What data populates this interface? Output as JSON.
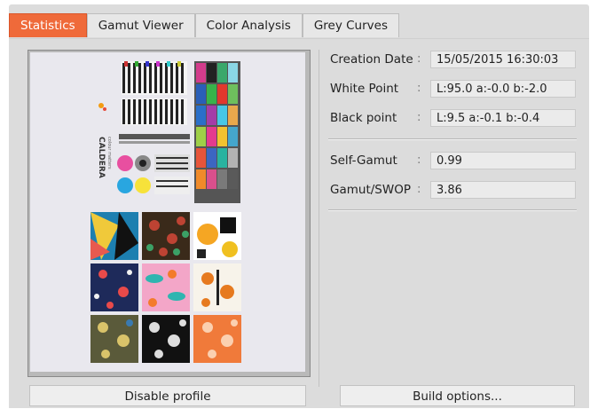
{
  "tabs": [
    {
      "label": "Statistics",
      "active": true
    },
    {
      "label": "Gamut Viewer",
      "active": false
    },
    {
      "label": "Color Analysis",
      "active": false
    },
    {
      "label": "Grey Curves",
      "active": false
    }
  ],
  "preview": {
    "logo_text": "CALDERA",
    "logo_subtext": "colour matters"
  },
  "stats": {
    "creation_date": {
      "label": "Creation Date",
      "value": "15/05/2015 16:30:03"
    },
    "white_point": {
      "label": "White Point",
      "value": "L:95.0 a:-0.0 b:-2.0"
    },
    "black_point": {
      "label": "Black point",
      "value": "L:9.5 a:-0.1 b:-0.4"
    },
    "self_gamut": {
      "label": "Self-Gamut",
      "value": "0.99"
    },
    "gamut_swop": {
      "label": "Gamut/SWOP",
      "value": "3.86"
    }
  },
  "buttons": {
    "disable_profile": "Disable profile",
    "build_options": "Build options..."
  },
  "colors": {
    "accent": "#ef6a3a",
    "panel": "#dcdcdc"
  }
}
